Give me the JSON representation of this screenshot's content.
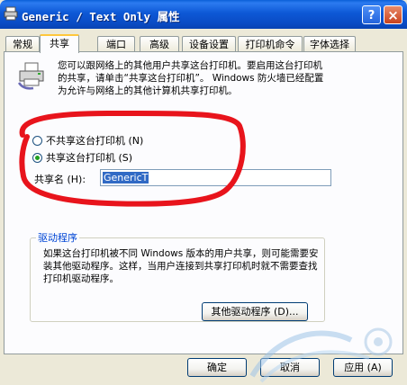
{
  "window": {
    "title": "Generic / Text Only 属性",
    "help_label": "?",
    "close_label": "×"
  },
  "tabs": [
    {
      "label": "常规"
    },
    {
      "label": "共享"
    },
    {
      "label": "端口"
    },
    {
      "label": "高级"
    },
    {
      "label": "设备设置"
    },
    {
      "label": "打印机命令"
    },
    {
      "label": "字体选择"
    }
  ],
  "sharing": {
    "description": "您可以跟网络上的其他用户共享这台打印机。要启用这台打印机的共享，请单击“共享这台打印机”。 Windows 防火墙已经配置为允许与网络上的其他计算机共享打印机。",
    "no_share_label": "不共享这台打印机 (N)",
    "share_label": "共享这台打印机 (S)",
    "share_name_label": "共享名 (H):",
    "share_name_value": "GenericT",
    "selected_option": "share"
  },
  "drivers": {
    "group_title": "驱动程序",
    "description": "如果这台打印机被不同 Windows 版本的用户共享，则可能需要安装其他驱动程序。这样，当用户连接到共享打印机时就不需要查找打印机驱动程序。",
    "other_drivers_button": "其他驱动程序 (D)..."
  },
  "footer": {
    "ok_label": "确定",
    "cancel_label": "取消",
    "apply_label": "应用 (A)"
  },
  "colors": {
    "titlebar": "#0a5fd8",
    "annotation_circle": "#e8141c",
    "group_title": "#0046d5"
  }
}
